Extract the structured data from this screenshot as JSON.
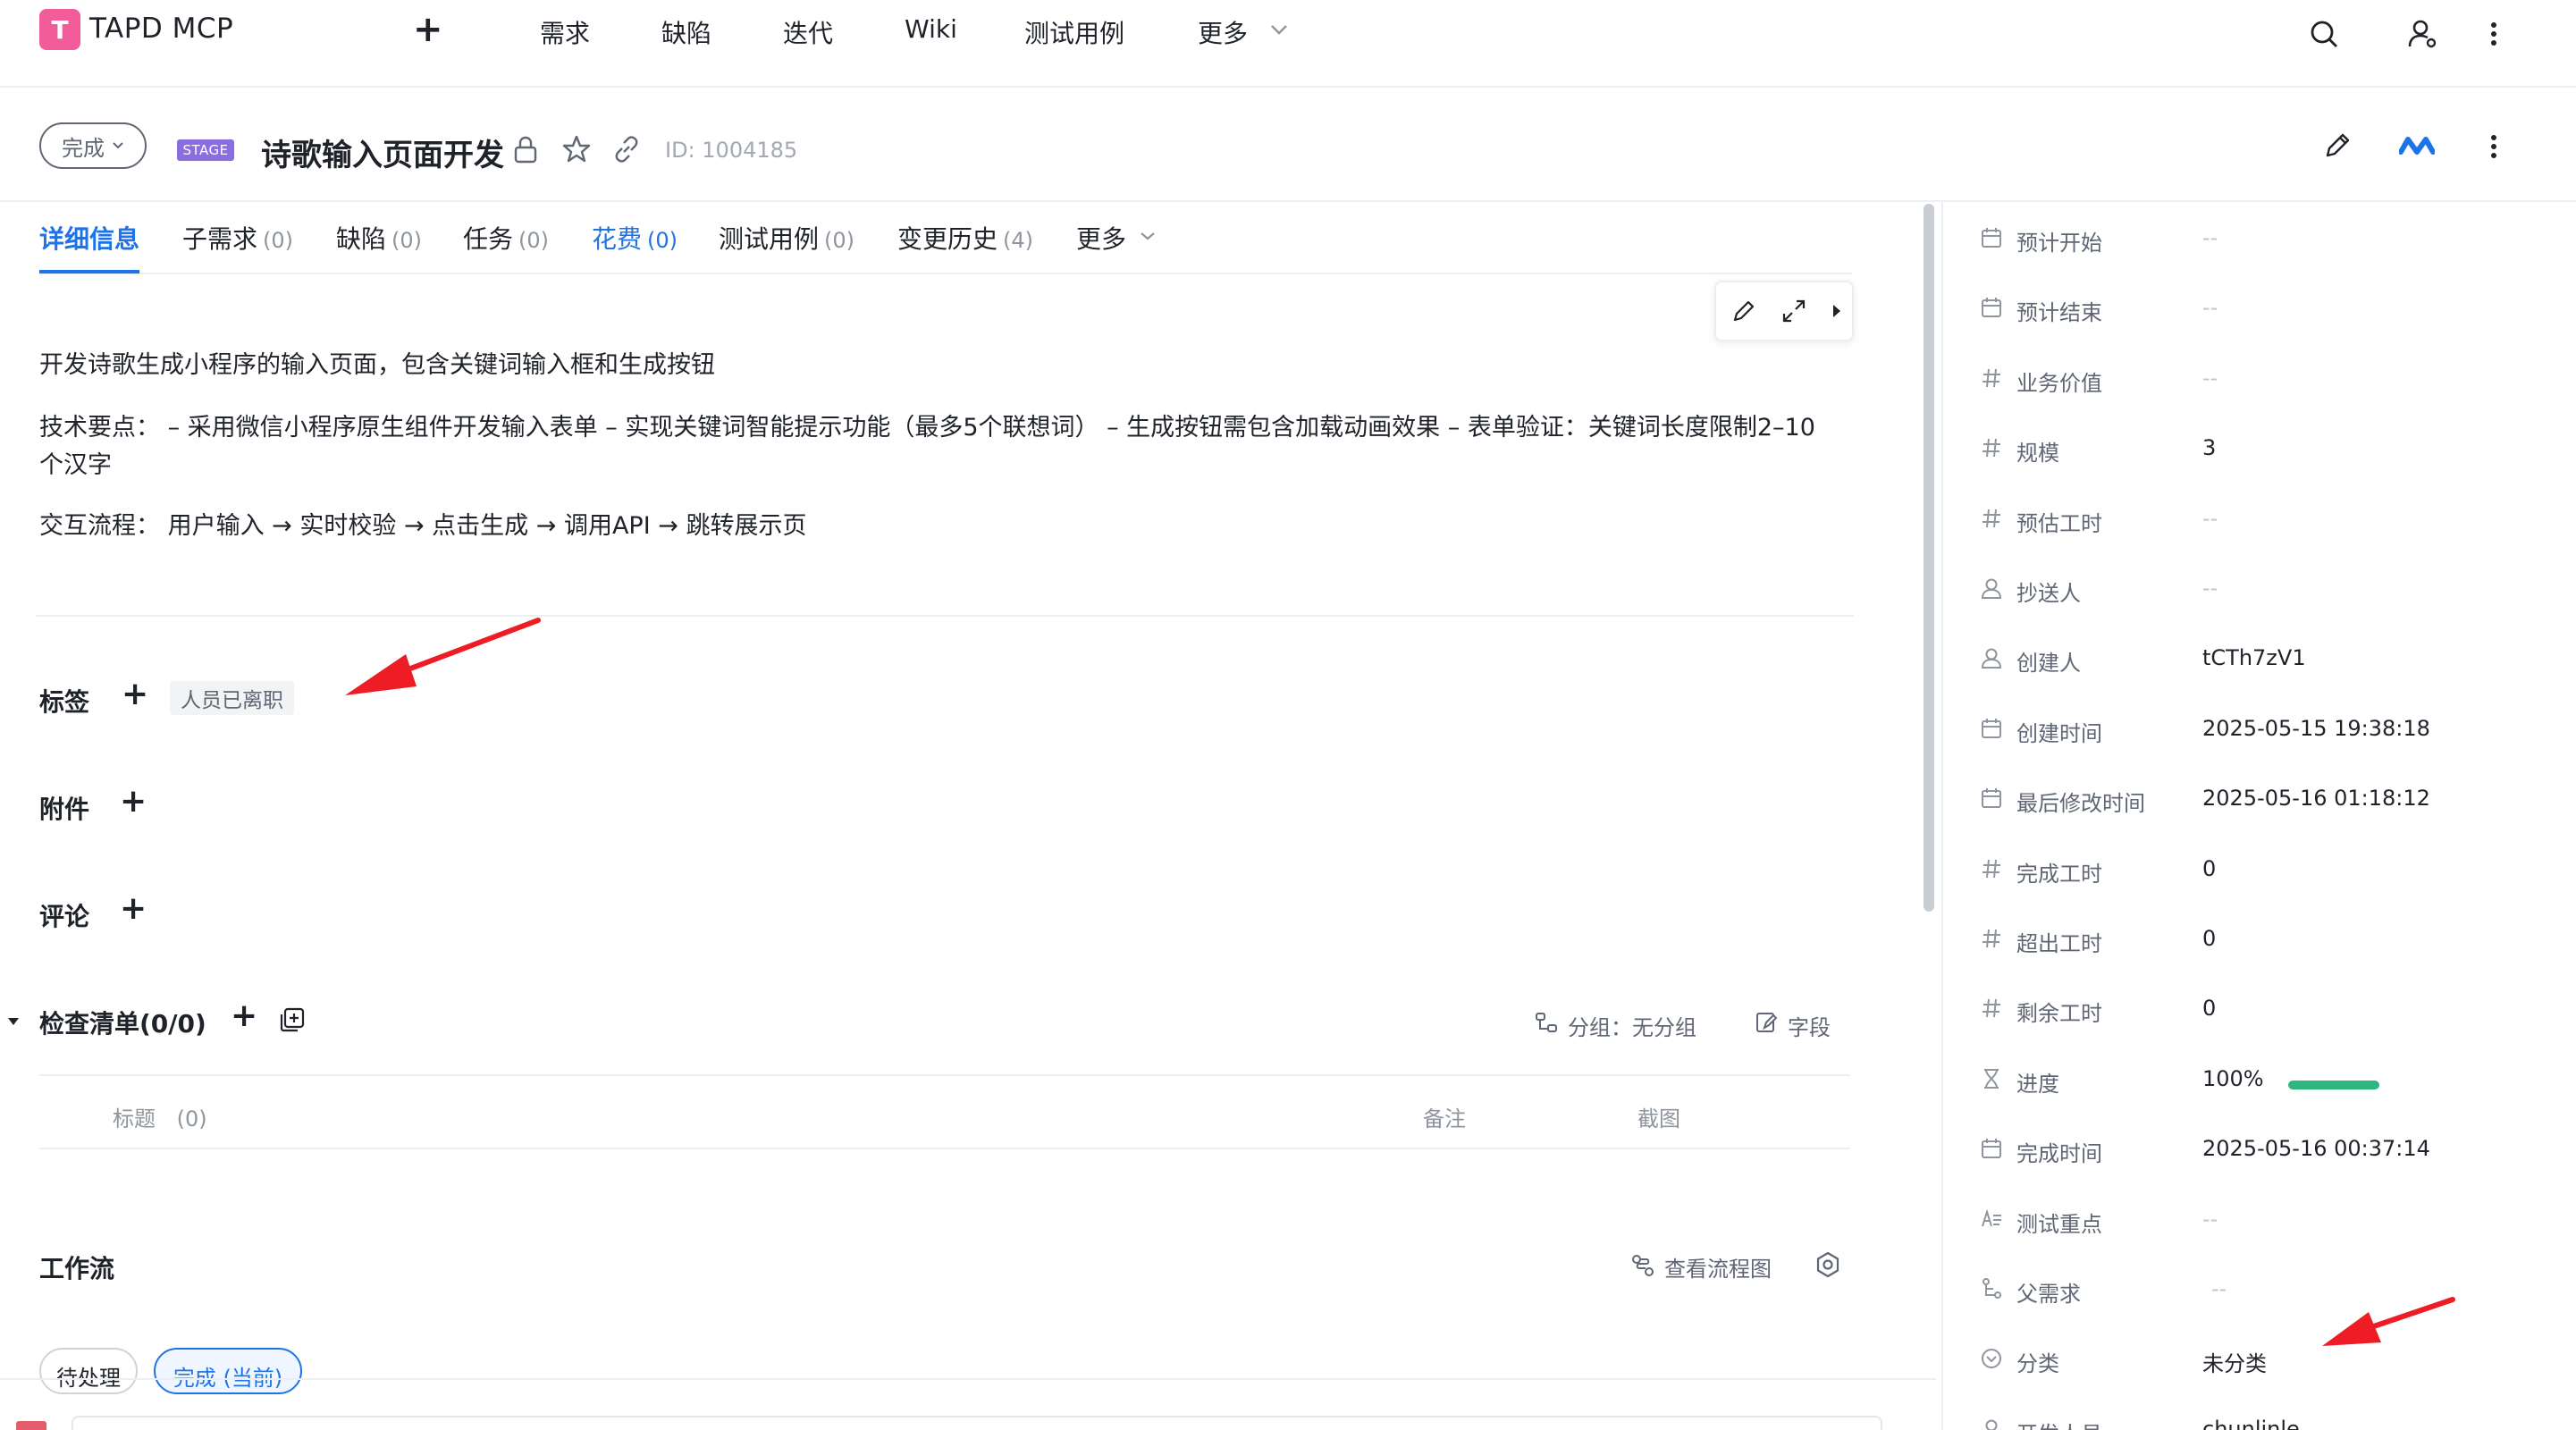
{
  "app": {
    "logo_letter": "T",
    "name": "TAPD MCP"
  },
  "topnav": {
    "items": [
      "需求",
      "缺陷",
      "迭代",
      "Wiki",
      "测试用例",
      "更多"
    ]
  },
  "story": {
    "status": "完成",
    "stage_badge": "STAGE",
    "title": "诗歌输入页面开发",
    "id_text": "ID: 1004185"
  },
  "tabs": [
    {
      "label": "详细信息",
      "count": ""
    },
    {
      "label": "子需求",
      "count": "(0)"
    },
    {
      "label": "缺陷",
      "count": "(0)"
    },
    {
      "label": "任务",
      "count": "(0)"
    },
    {
      "label": "花费",
      "count": "(0)"
    },
    {
      "label": "测试用例",
      "count": "(0)"
    },
    {
      "label": "变更历史",
      "count": "(4)"
    },
    {
      "label": "更多",
      "count": ""
    }
  ],
  "description": {
    "p1": "开发诗歌生成小程序的输入页面，包含关键词输入框和生成按钮",
    "p2": "技术要点： – 采用微信小程序原生组件开发输入表单 – 实现关键词智能提示功能（最多5个联想词） – 生成按钮需包含加载动画效果 – 表单验证：关键词长度限制2–10个汉字",
    "p3": "交互流程：  用户输入 → 实时校验 → 点击生成 → 调用API → 跳转展示页"
  },
  "sections": {
    "tags": {
      "title": "标签",
      "chip": "人员已离职"
    },
    "attachments": {
      "title": "附件"
    },
    "comments": {
      "title": "评论"
    },
    "checklist": {
      "title": "检查清单(0/0)",
      "group_label": "分组：无分组",
      "fields_label": "字段",
      "col_title": "标题",
      "col_title_count": "(0)",
      "col_remark": "备注",
      "col_screenshot": "截图"
    },
    "workflow": {
      "title": "工作流",
      "view_flow": "查看流程图",
      "states": [
        "待处理",
        "完成 (当前)"
      ]
    }
  },
  "fields": [
    {
      "icon": "calendar-icon",
      "label": "预计开始",
      "value": "--"
    },
    {
      "icon": "calendar-icon",
      "label": "预计结束",
      "value": "--"
    },
    {
      "icon": "hash-icon",
      "label": "业务价值",
      "value": "--"
    },
    {
      "icon": "hash-icon",
      "label": "规模",
      "value": "3"
    },
    {
      "icon": "hash-icon",
      "label": "预估工时",
      "value": "--"
    },
    {
      "icon": "person-icon",
      "label": "抄送人",
      "value": "--"
    },
    {
      "icon": "person-icon",
      "label": "创建人",
      "value": "tCTh7zV1"
    },
    {
      "icon": "calendar-icon",
      "label": "创建时间",
      "value": "2025-05-15 19:38:18"
    },
    {
      "icon": "calendar-icon",
      "label": "最后修改时间",
      "value": "2025-05-16 01:18:12"
    },
    {
      "icon": "hash-icon",
      "label": "完成工时",
      "value": "0"
    },
    {
      "icon": "hash-icon",
      "label": "超出工时",
      "value": "0"
    },
    {
      "icon": "hash-icon",
      "label": "剩余工时",
      "value": "0"
    },
    {
      "icon": "hourglass-icon",
      "label": "进度",
      "value": "100%",
      "progress": 1.0
    },
    {
      "icon": "calendar-icon",
      "label": "完成时间",
      "value": "2025-05-16 00:37:14"
    },
    {
      "icon": "text-icon",
      "label": "测试重点",
      "value": "--"
    },
    {
      "icon": "tree-icon",
      "label": "父需求",
      "value": "--"
    },
    {
      "icon": "category-icon",
      "label": "分类",
      "value": "未分类"
    },
    {
      "icon": "person-icon",
      "label": "开发人员",
      "value": "chunlinle"
    }
  ],
  "colors": {
    "accent": "#1e73e8",
    "logo": "#f25c9a",
    "stage": "#8a6dde",
    "progress": "#2eb67d",
    "annotation_arrow": "#ee1c25"
  }
}
